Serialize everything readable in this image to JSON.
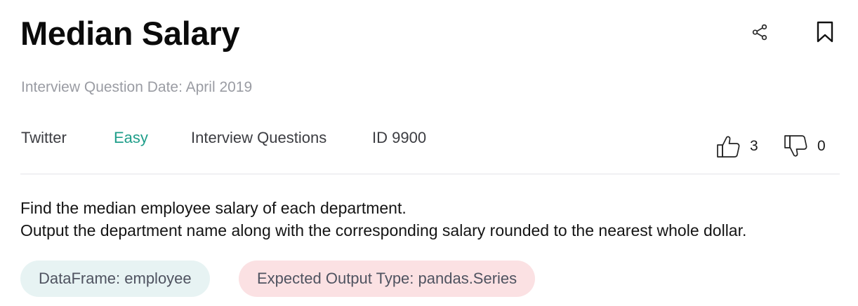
{
  "question": {
    "title": "Median Salary",
    "date_text": "Interview Question Date: April 2019",
    "company": "Twitter",
    "difficulty": "Easy",
    "category": "Interview Questions",
    "id_text": "ID 9900",
    "upvotes": "3",
    "downvotes": "0",
    "description_line1": "Find the median employee salary of each department.",
    "description_line2": "Output the department name along with the corresponding salary rounded to the nearest whole dollar.",
    "dataframe_chip": "DataFrame: employee",
    "output_chip": "Expected Output Type: pandas.Series"
  },
  "icons": {
    "share": "share-icon",
    "bookmark": "bookmark-icon",
    "upvote": "thumbs-up-icon",
    "downvote": "thumbs-down-icon"
  },
  "colors": {
    "difficulty_easy": "#1f9e8a",
    "dataframe_chip_bg": "#e7f3f3",
    "output_chip_bg": "#fbe1e3",
    "muted_text": "#9a9ca3"
  }
}
